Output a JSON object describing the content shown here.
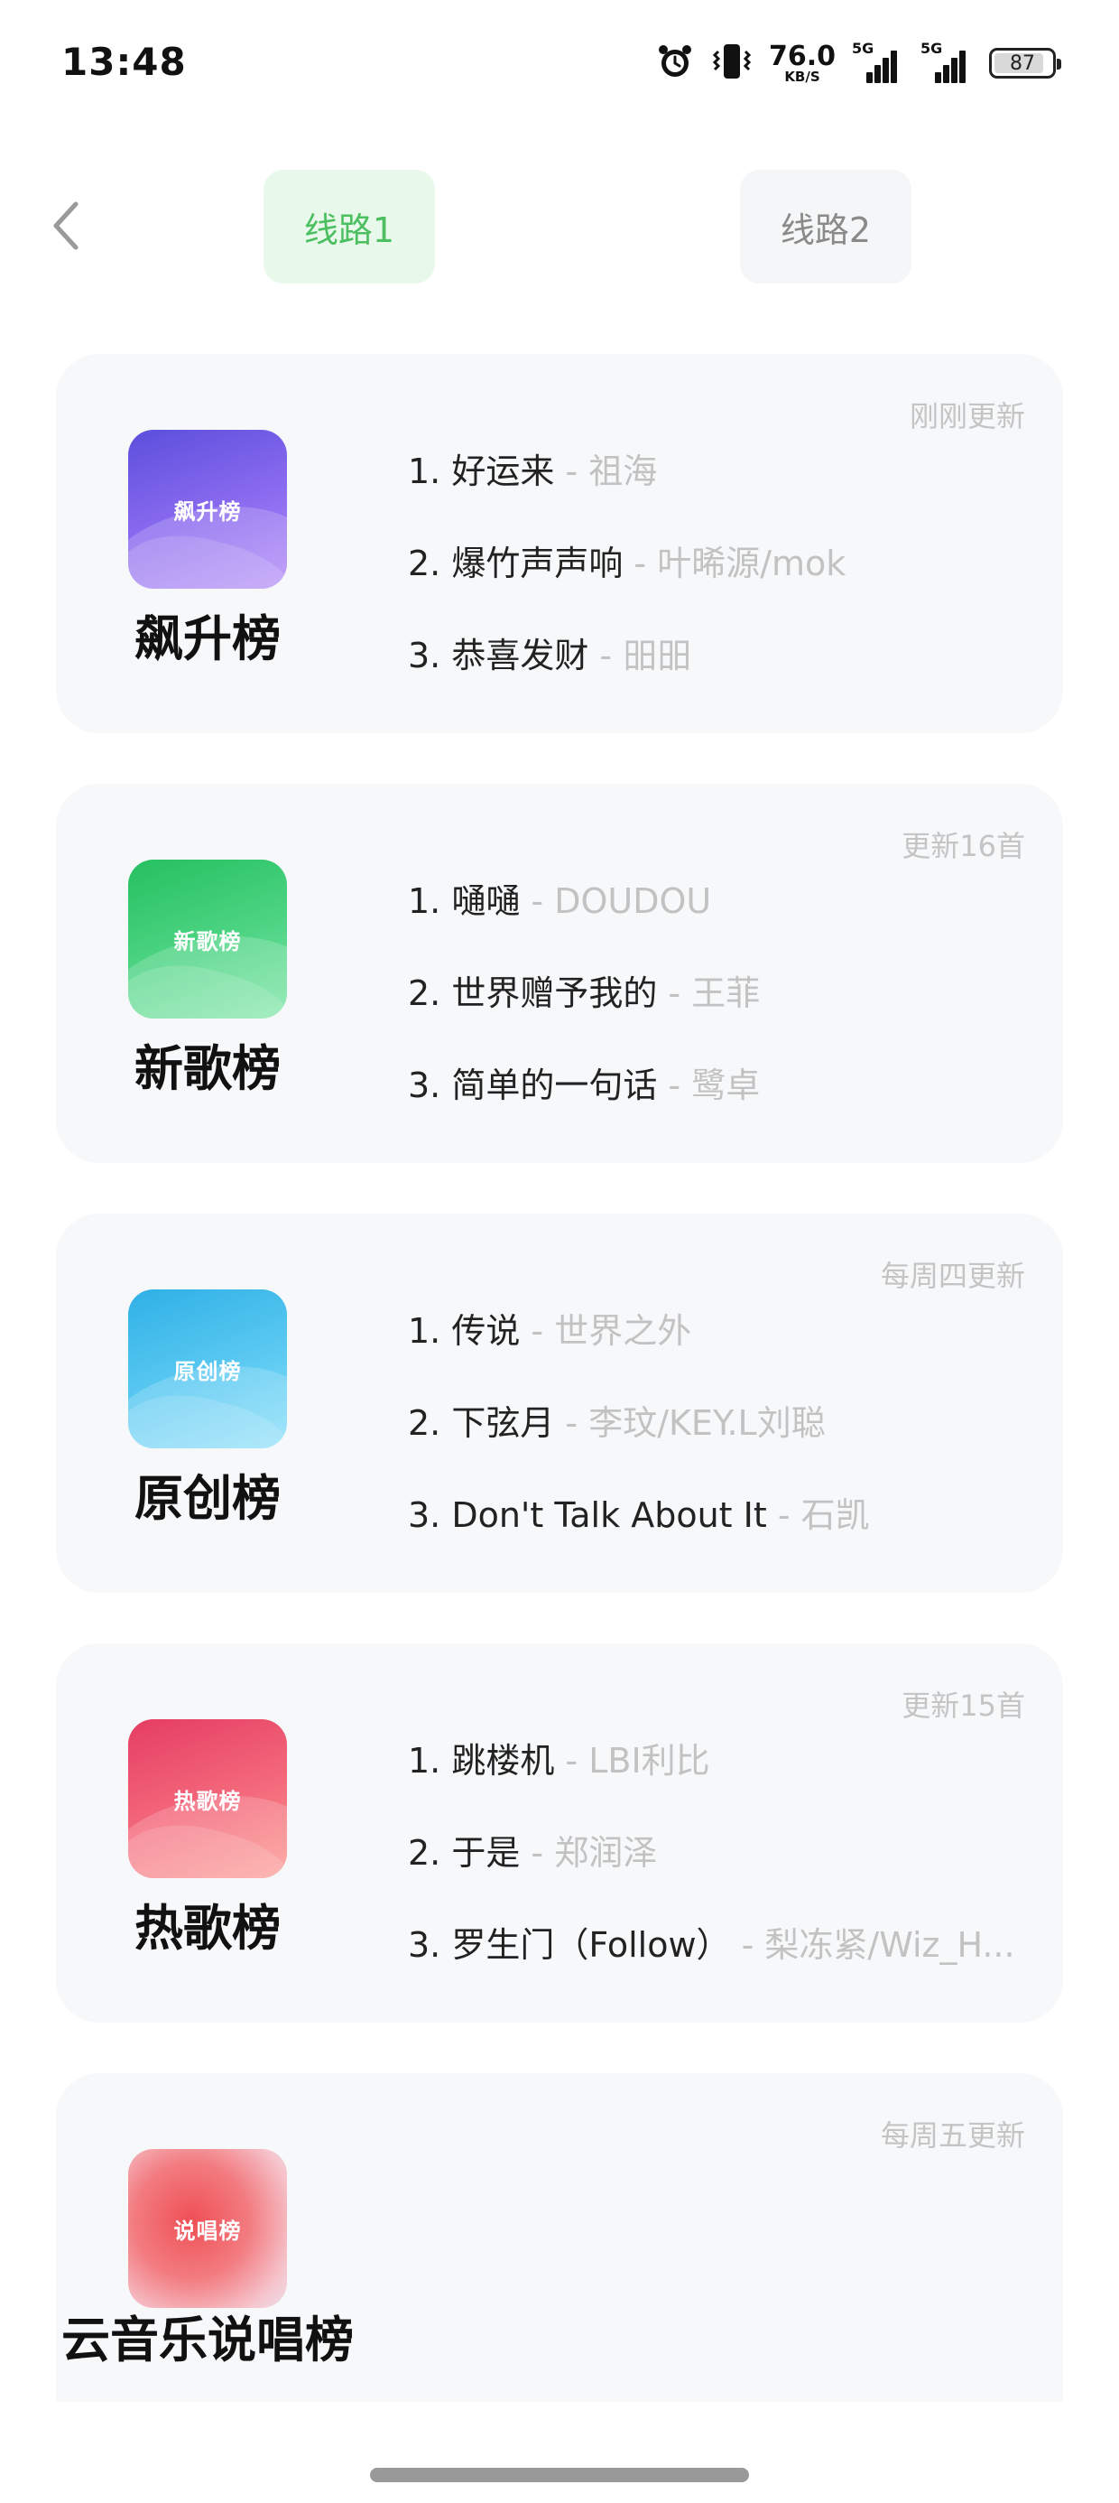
{
  "status": {
    "time": "13:48",
    "speed_value": "76.0",
    "speed_unit": "KB/S",
    "signal1_tag": "5G",
    "signal2_tag": "5G",
    "battery": "87"
  },
  "nav": {
    "tab1": "线路1",
    "tab2": "线路2",
    "active_color": "#4cc061"
  },
  "charts": [
    {
      "name": "飙升榜",
      "cover_label": "飙升榜",
      "update": "刚刚更新",
      "colors": [
        "#6a5be0",
        "#a37cf0"
      ],
      "songs": [
        {
          "title": "1. 好运来",
          "artist": " - 祖海"
        },
        {
          "title": "2. 爆竹声声响",
          "artist": " - 叶晞源/mok"
        },
        {
          "title": "3. 恭喜发财",
          "artist": " - 昍昍"
        }
      ]
    },
    {
      "name": "新歌榜",
      "cover_label": "新歌榜",
      "update": "更新16首",
      "colors": [
        "#2ec46b",
        "#6fe29a"
      ],
      "songs": [
        {
          "title": "1. 嗵嗵",
          "artist": " - DOUDOU"
        },
        {
          "title": "2. 世界赠予我的",
          "artist": " - 王菲"
        },
        {
          "title": "3. 简单的一句话",
          "artist": " - 鹭卓"
        }
      ]
    },
    {
      "name": "原创榜",
      "cover_label": "原创榜",
      "update": "每周四更新",
      "colors": [
        "#3ab8ea",
        "#7fd9f8"
      ],
      "songs": [
        {
          "title": "1. 传说",
          "artist": " - 世界之外"
        },
        {
          "title": "2. 下弦月",
          "artist": " - 李玟/KEY.L刘聪"
        },
        {
          "title": "3. Don't Talk About It",
          "artist": " - 石凯"
        }
      ]
    },
    {
      "name": "热歌榜",
      "cover_label": "热歌榜",
      "update": "更新15首",
      "colors": [
        "#e8446a",
        "#fb8a8a"
      ],
      "songs": [
        {
          "title": "1. 跳楼机",
          "artist": " - LBI利比"
        },
        {
          "title": "2. 于是",
          "artist": " - 郑润泽"
        },
        {
          "title": "3. 罗生门（Follow）",
          "artist": " - 梨冻紧/Wiz_H..."
        }
      ]
    },
    {
      "name": "云音乐说唱榜",
      "cover_label": "说唱榜",
      "update": "每周五更新",
      "colors": [
        "#ef5a5a",
        "#f5b2bd"
      ],
      "songs": []
    }
  ]
}
